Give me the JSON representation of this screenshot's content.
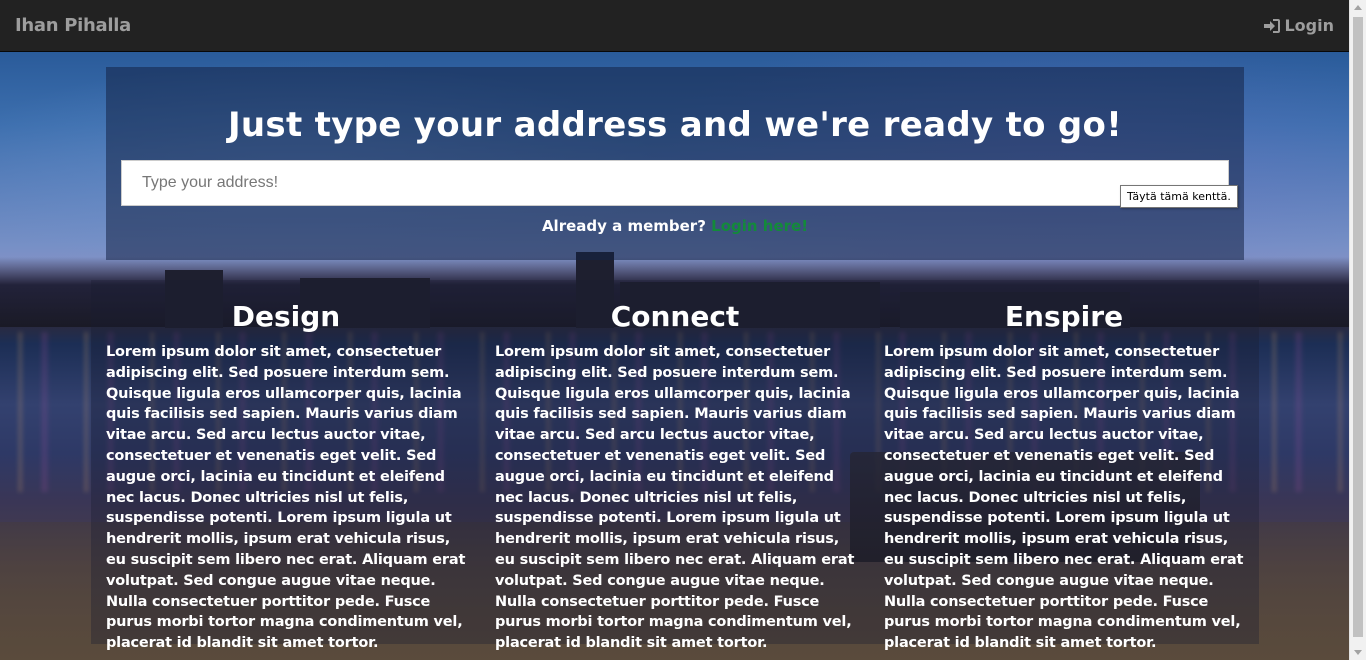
{
  "navbar": {
    "brand": "Ihan Pihalla",
    "login_label": "Login",
    "login_icon": "sign-in-icon"
  },
  "hero": {
    "heading": "Just type your address and we're ready to go!",
    "address_placeholder": "Type your address!",
    "address_value": "",
    "validation_tooltip": "Täytä tämä kenttä.",
    "member_text": "Already a member?",
    "login_here": "Login here!"
  },
  "features": [
    {
      "title": "Design",
      "text": "Lorem ipsum dolor sit amet, consectetuer adipiscing elit. Sed posuere interdum sem. Quisque ligula eros ullamcorper quis, lacinia quis facilisis sed sapien. Mauris varius diam vitae arcu. Sed arcu lectus auctor vitae, consectetuer et venenatis eget velit. Sed augue orci, lacinia eu tincidunt et eleifend nec lacus. Donec ultricies nisl ut felis, suspendisse potenti. Lorem ipsum ligula ut hendrerit mollis, ipsum erat vehicula risus, eu suscipit sem libero nec erat. Aliquam erat volutpat. Sed congue augue vitae neque. Nulla consectetuer porttitor pede. Fusce purus morbi tortor magna condimentum vel, placerat id blandit sit amet tortor."
    },
    {
      "title": "Connect",
      "text": "Lorem ipsum dolor sit amet, consectetuer adipiscing elit. Sed posuere interdum sem. Quisque ligula eros ullamcorper quis, lacinia quis facilisis sed sapien. Mauris varius diam vitae arcu. Sed arcu lectus auctor vitae, consectetuer et venenatis eget velit. Sed augue orci, lacinia eu tincidunt et eleifend nec lacus. Donec ultricies nisl ut felis, suspendisse potenti. Lorem ipsum ligula ut hendrerit mollis, ipsum erat vehicula risus, eu suscipit sem libero nec erat. Aliquam erat volutpat. Sed congue augue vitae neque. Nulla consectetuer porttitor pede. Fusce purus morbi tortor magna condimentum vel, placerat id blandit sit amet tortor."
    },
    {
      "title": "Enspire",
      "text": "Lorem ipsum dolor sit amet, consectetuer adipiscing elit. Sed posuere interdum sem. Quisque ligula eros ullamcorper quis, lacinia quis facilisis sed sapien. Mauris varius diam vitae arcu. Sed arcu lectus auctor vitae, consectetuer et venenatis eget velit. Sed augue orci, lacinia eu tincidunt et eleifend nec lacus. Donec ultricies nisl ut felis, suspendisse potenti. Lorem ipsum ligula ut hendrerit mollis, ipsum erat vehicula risus, eu suscipit sem libero nec erat. Aliquam erat volutpat. Sed congue augue vitae neque. Nulla consectetuer porttitor pede. Fusce purus morbi tortor magna condimentum vel, placerat id blandit sit amet tortor."
    }
  ],
  "colors": {
    "navbar_bg": "#222222",
    "navbar_text": "#9d9d9d",
    "login_here_link": "#138a3a",
    "text": "#ffffff"
  }
}
